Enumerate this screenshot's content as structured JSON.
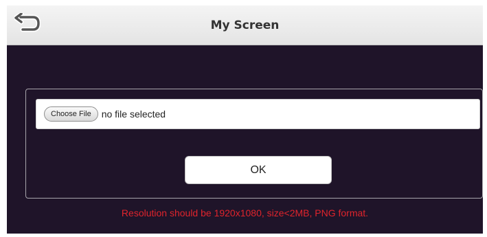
{
  "window": {
    "title": "My Screen"
  },
  "icons": {
    "back": "back-arrow-icon"
  },
  "upload": {
    "choose_label": "Choose File",
    "file_status": "no file selected",
    "ok_label": "OK"
  },
  "hint_text": "Resolution should be 1920x1080, size<2MB, PNG format.",
  "colors": {
    "background": "#1f1429",
    "titlebar": "#eeeeee",
    "hint": "#e0242c"
  }
}
